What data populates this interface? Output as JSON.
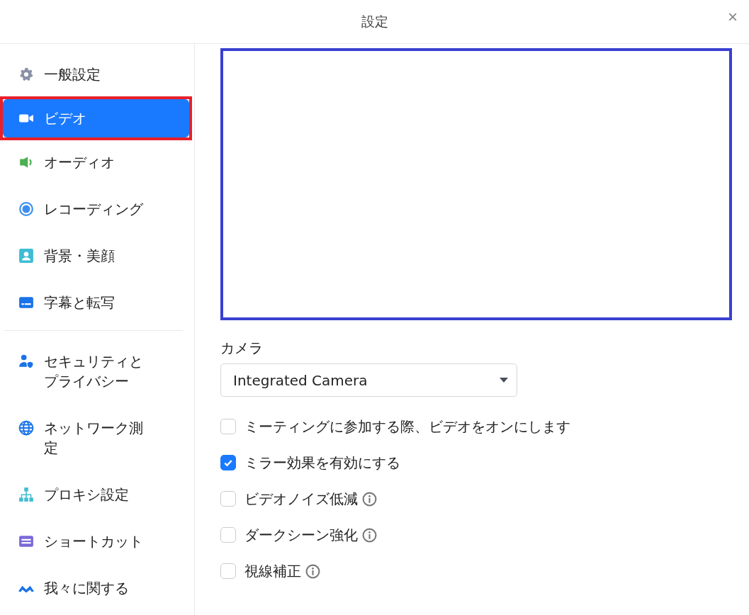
{
  "window": {
    "title": "設定",
    "close": "×"
  },
  "sidebar": {
    "groups": [
      [
        {
          "label": "一般設定",
          "selected": false,
          "highlighted": false
        },
        {
          "label": "ビデオ",
          "selected": true,
          "highlighted": true
        },
        {
          "label": "オーディオ",
          "selected": false,
          "highlighted": false
        },
        {
          "label": "レコーディング",
          "selected": false,
          "highlighted": false
        },
        {
          "label": "背景・美顔",
          "selected": false,
          "highlighted": false
        },
        {
          "label": "字幕と転写",
          "selected": false,
          "highlighted": false
        }
      ],
      [
        {
          "label": "セキュリティとプライバシー",
          "selected": false,
          "highlighted": false
        },
        {
          "label": "ネットワーク測定",
          "selected": false,
          "highlighted": false
        },
        {
          "label": "プロキシ設定",
          "selected": false,
          "highlighted": false
        },
        {
          "label": "ショートカット",
          "selected": false,
          "highlighted": false
        },
        {
          "label": "我々に関する",
          "selected": false,
          "highlighted": false
        }
      ]
    ]
  },
  "camera": {
    "label": "カメラ",
    "value": "Integrated Camera"
  },
  "options": [
    {
      "label": "ミーティングに参加する際、ビデオをオンにします",
      "checked": false,
      "info": false
    },
    {
      "label": "ミラー効果を有効にする",
      "checked": true,
      "info": false
    },
    {
      "label": "ビデオノイズ低減",
      "checked": false,
      "info": true
    },
    {
      "label": "ダークシーン強化",
      "checked": false,
      "info": true
    },
    {
      "label": "視線補正",
      "checked": false,
      "info": true
    }
  ]
}
